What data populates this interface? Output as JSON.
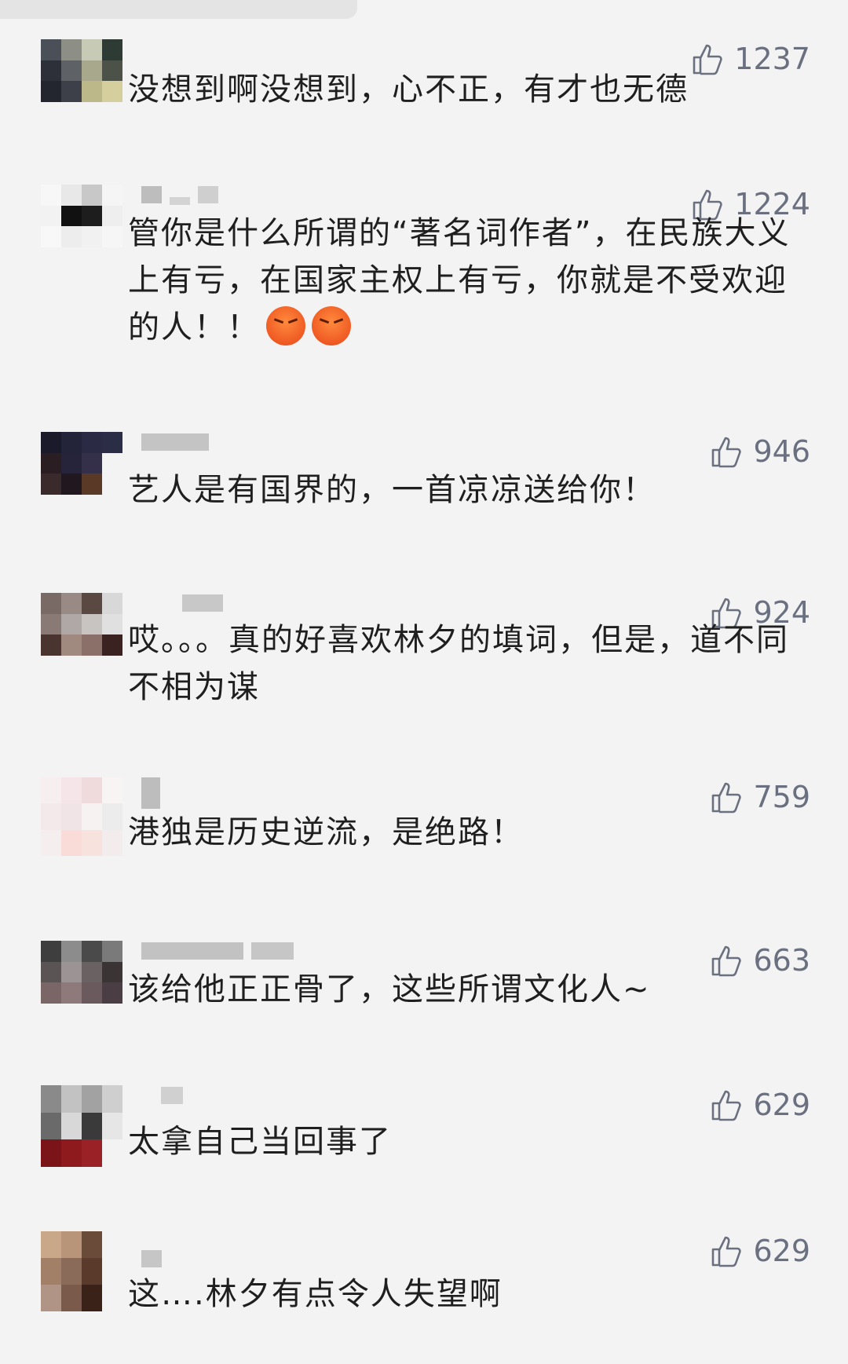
{
  "colors": {
    "background": "#f3f3f3",
    "like_text": "#6a7080",
    "comment_text": "#1f1f1f"
  },
  "icons": {
    "like": "thumbs-up-icon",
    "emoji": "angry-face-emoji"
  },
  "comments": [
    {
      "likes": "1237",
      "text": "没想到啊没想到，心不正，有才也无德"
    },
    {
      "likes": "1224",
      "text": "管你是什么所谓的“著名词作者”，在民族大义上有亏，在国家主权上有亏，你就是不受欢迎的人！！",
      "emoji_count": 2
    },
    {
      "likes": "946",
      "text": "艺人是有国界的，一首凉凉送给你！"
    },
    {
      "likes": "924",
      "text": "哎。。。真的好喜欢林夕的填词，但是，道不同不相为谋"
    },
    {
      "likes": "759",
      "text": "港独是历史逆流，是绝路！"
    },
    {
      "likes": "663",
      "text": "该给他正正骨了，这些所谓文化人~"
    },
    {
      "likes": "629",
      "text": "太拿自己当回事了"
    },
    {
      "likes": "629",
      "text": "这….林夕有点令人失望啊"
    }
  ]
}
